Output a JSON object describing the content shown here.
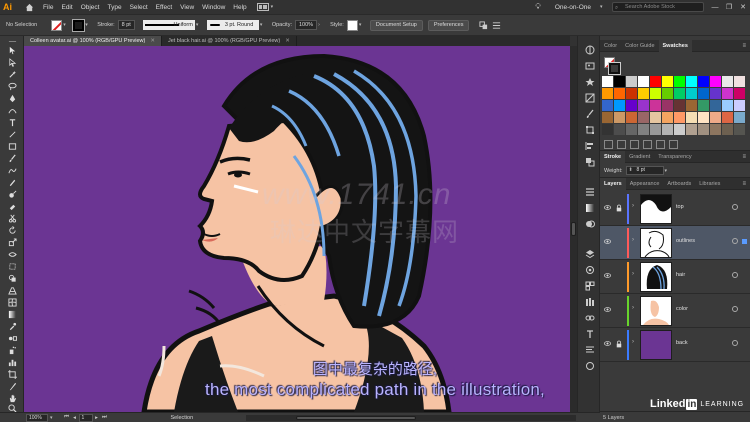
{
  "app": {
    "logo": "Ai",
    "menu": [
      "File",
      "Edit",
      "Object",
      "Type",
      "Select",
      "Effect",
      "View",
      "Window",
      "Help"
    ],
    "workspace": "One-on-One",
    "stock_search_placeholder": "Search Adobe Stock",
    "window_controls": [
      "—",
      "❐",
      "✕"
    ]
  },
  "control_bar": {
    "selection_label": "No Selection",
    "stroke_label": "Stroke:",
    "stroke_weight": "8 pt",
    "stroke_profile": "Uniform",
    "brush": "3 pt. Round",
    "opacity_label": "Opacity:",
    "opacity_value": "100%",
    "style_label": "Style:",
    "document_setup": "Document Setup",
    "preferences": "Preferences"
  },
  "tabs": [
    {
      "label": "Colleen avatar.ai @ 100% (RGB/GPU Preview)",
      "active": true
    },
    {
      "label": "Jet black hair.ai @ 100% (RGB/GPU Preview)",
      "active": false
    }
  ],
  "status_bar": {
    "zoom": "100%",
    "artboard": "1",
    "mode": "Selection"
  },
  "swatches_panel": {
    "tabs": [
      "Color",
      "Color Guide",
      "Swatches"
    ],
    "active_tab": "Swatches",
    "colors": [
      "#ffffff",
      "#000000",
      "#cccccc",
      "#ffffff",
      "#ff0000",
      "#ffff00",
      "#00ff00",
      "#00ffff",
      "#0000ff",
      "#ff00ff",
      "#e8e8e8",
      "#f0e0e0",
      "#ff9900",
      "#ff6600",
      "#cc3300",
      "#ffcc00",
      "#ccff00",
      "#66cc00",
      "#00cc66",
      "#00cccc",
      "#0066cc",
      "#6633cc",
      "#cc33cc",
      "#cc0066",
      "#3366cc",
      "#0099ff",
      "#6600cc",
      "#9933cc",
      "#cc3399",
      "#993366",
      "#663333",
      "#996633",
      "#339966",
      "#336699",
      "#99ccff",
      "#ccccff",
      "#996633",
      "#cc9966",
      "#cc6633",
      "#996666",
      "#e6c6a0",
      "#f4a460",
      "#ff9966",
      "#f5deb3",
      "#ffe4c4",
      "#eeaa88",
      "#dd6644",
      "#7aaacc",
      "#333333",
      "#4d4d4d",
      "#666666",
      "#808080",
      "#999999",
      "#b3b3b3",
      "#cccccc",
      "#b0a090",
      "#a09080",
      "#8d7660",
      "#6d6050",
      "#555550"
    ]
  },
  "stroke_panel": {
    "tabs": [
      "Stroke",
      "Gradient",
      "Transparency"
    ],
    "weight_label": "Weight:",
    "weight_value": "8 pt"
  },
  "layers_panel": {
    "tabs": [
      "Layers",
      "Appearance",
      "Artboards",
      "Libraries"
    ],
    "layers": [
      {
        "name": "top",
        "color": "#5a74ff",
        "locked": true,
        "selected": false
      },
      {
        "name": "outlines",
        "color": "#ff5a5a",
        "locked": false,
        "selected": true
      },
      {
        "name": "hair",
        "color": "#ff9a2a",
        "locked": false,
        "selected": false
      },
      {
        "name": "color",
        "color": "#68d42c",
        "locked": false,
        "selected": false
      },
      {
        "name": "back",
        "color": "#3b7bff",
        "locked": true,
        "selected": false
      }
    ],
    "count_label": "5 Layers"
  },
  "overlay": {
    "watermark_latin": "www.1741.cn",
    "watermark_cjk": "琳达中文字幕网",
    "subtitle_cn": "图中最复杂的路径,",
    "subtitle_en": "the most complicated path in the illustration,",
    "brand": "Linked",
    "brand_in": "in",
    "brand_learning": "LEARNING"
  },
  "colors": {
    "canvas": "#6b3593",
    "skin": "#f6c3a4",
    "hair_highlight": "#6ea4e0",
    "accent": "#ff9a00"
  }
}
